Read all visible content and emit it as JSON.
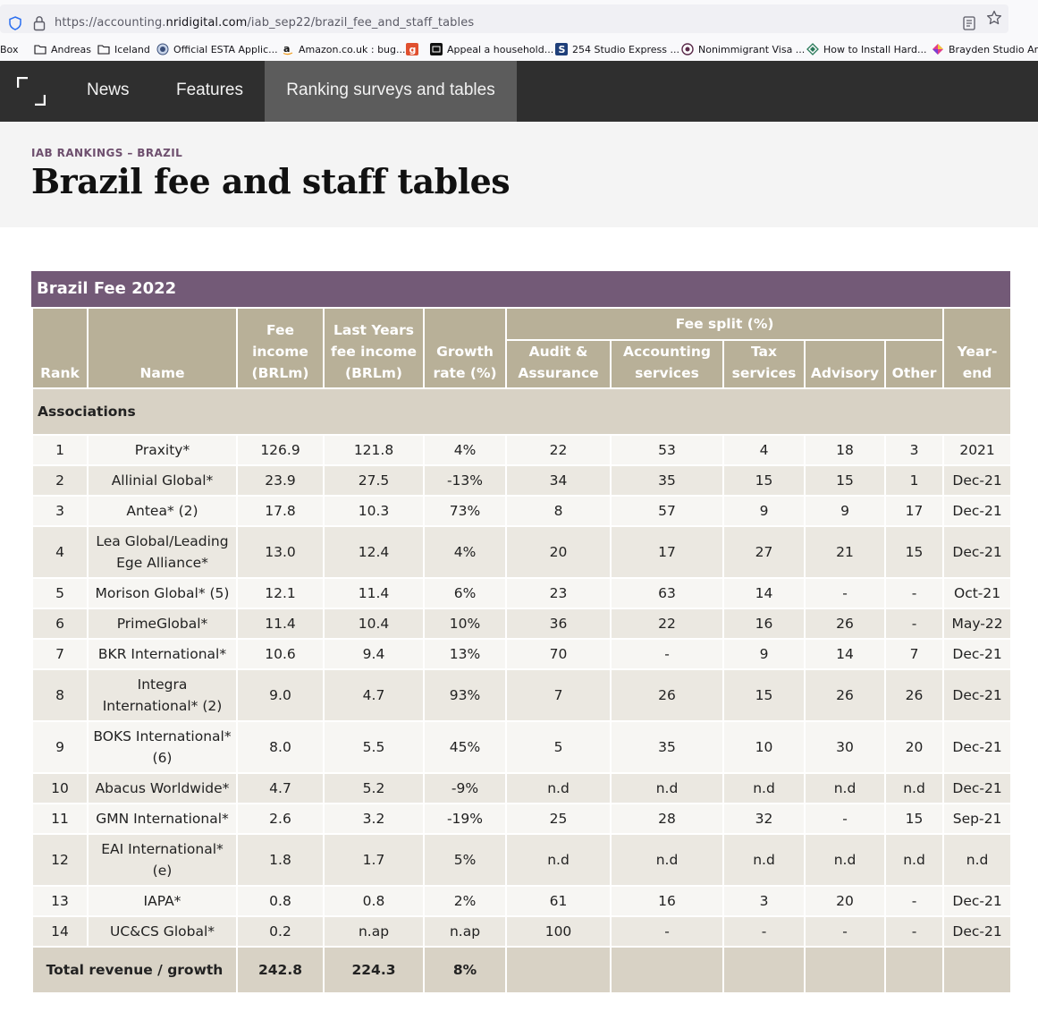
{
  "browser": {
    "url_prefix": "https://accounting.",
    "url_domain": "nridigital.com",
    "url_path": "/iab_sep22/brazil_fee_and_staff_tables",
    "bookmarks": [
      {
        "label": "Box",
        "icon": "folder-icon"
      },
      {
        "label": "Andreas",
        "icon": "folder-icon"
      },
      {
        "label": "Iceland",
        "icon": "folder-icon"
      },
      {
        "label": "Official ESTA Applic...",
        "icon": "seal-icon"
      },
      {
        "label": "Amazon.co.uk : bug...",
        "icon": "amazon-icon"
      },
      {
        "label": "",
        "icon": "g-icon"
      },
      {
        "label": "Appeal a household...",
        "icon": "gov-icon"
      },
      {
        "label": "254 Studio Express ...",
        "icon": "s-icon"
      },
      {
        "label": "Nonimmigrant Visa ...",
        "icon": "seal-icon"
      },
      {
        "label": "How to Install Hard...",
        "icon": "diamond-icon"
      },
      {
        "label": "Brayden Studio Ara...",
        "icon": "colorful-icon"
      }
    ]
  },
  "nav": {
    "items": [
      "News",
      "Features",
      "Ranking surveys and tables"
    ]
  },
  "header": {
    "kicker": "IAB RANKINGS – BRAZIL",
    "title": "Brazil fee and staff tables"
  },
  "table": {
    "title": "Brazil Fee 2022",
    "headers": {
      "rank": "Rank",
      "name": "Name",
      "fee_income": [
        "Fee",
        "income",
        "(BRLm)"
      ],
      "last_years": [
        "Last Years",
        "fee income",
        "(BRLm)"
      ],
      "growth": [
        "Growth",
        "rate (%)"
      ],
      "fee_split": "Fee split (%)",
      "audit": [
        "Audit &",
        "Assurance"
      ],
      "accounting": [
        "Accounting",
        "services"
      ],
      "tax": [
        "Tax",
        "services"
      ],
      "advisory": "Advisory",
      "other": "Other",
      "year_end": [
        "Year-",
        "end"
      ]
    },
    "section": "Associations",
    "rows": [
      {
        "rank": "1",
        "name": [
          "Praxity*"
        ],
        "fee": "126.9",
        "last": "121.8",
        "growth": "4%",
        "audit": "22",
        "acc": "53",
        "tax": "4",
        "adv": "18",
        "other": "3",
        "ye": "2021"
      },
      {
        "rank": "2",
        "name": [
          "Allinial Global*"
        ],
        "fee": "23.9",
        "last": "27.5",
        "growth": "-13%",
        "audit": "34",
        "acc": "35",
        "tax": "15",
        "adv": "15",
        "other": "1",
        "ye": "Dec-21"
      },
      {
        "rank": "3",
        "name": [
          "Antea* (2)"
        ],
        "fee": "17.8",
        "last": "10.3",
        "growth": "73%",
        "audit": "8",
        "acc": "57",
        "tax": "9",
        "adv": "9",
        "other": "17",
        "ye": "Dec-21"
      },
      {
        "rank": "4",
        "name": [
          "Lea Global/Leading",
          "Ege Alliance*"
        ],
        "fee": "13.0",
        "last": "12.4",
        "growth": "4%",
        "audit": "20",
        "acc": "17",
        "tax": "27",
        "adv": "21",
        "other": "15",
        "ye": "Dec-21"
      },
      {
        "rank": "5",
        "name": [
          "Morison Global* (5)"
        ],
        "fee": "12.1",
        "last": "11.4",
        "growth": "6%",
        "audit": "23",
        "acc": "63",
        "tax": "14",
        "adv": "-",
        "other": "-",
        "ye": "Oct-21"
      },
      {
        "rank": "6",
        "name": [
          "PrimeGlobal*"
        ],
        "fee": "11.4",
        "last": "10.4",
        "growth": "10%",
        "audit": "36",
        "acc": "22",
        "tax": "16",
        "adv": "26",
        "other": "-",
        "ye": "May-22"
      },
      {
        "rank": "7",
        "name": [
          "BKR International*"
        ],
        "fee": "10.6",
        "last": "9.4",
        "growth": "13%",
        "audit": "70",
        "acc": "-",
        "tax": "9",
        "adv": "14",
        "other": "7",
        "ye": "Dec-21"
      },
      {
        "rank": "8",
        "name": [
          "Integra",
          "International* (2)"
        ],
        "fee": "9.0",
        "last": "4.7",
        "growth": "93%",
        "audit": "7",
        "acc": "26",
        "tax": "15",
        "adv": "26",
        "other": "26",
        "ye": "Dec-21"
      },
      {
        "rank": "9",
        "name": [
          "BOKS International*",
          "(6)"
        ],
        "fee": "8.0",
        "last": "5.5",
        "growth": "45%",
        "audit": "5",
        "acc": "35",
        "tax": "10",
        "adv": "30",
        "other": "20",
        "ye": "Dec-21"
      },
      {
        "rank": "10",
        "name": [
          "Abacus Worldwide*"
        ],
        "fee": "4.7",
        "last": "5.2",
        "growth": "-9%",
        "audit": "n.d",
        "acc": "n.d",
        "tax": "n.d",
        "adv": "n.d",
        "other": "n.d",
        "ye": "Dec-21"
      },
      {
        "rank": "11",
        "name": [
          "GMN International*"
        ],
        "fee": "2.6",
        "last": "3.2",
        "growth": "-19%",
        "audit": "25",
        "acc": "28",
        "tax": "32",
        "adv": "-",
        "other": "15",
        "ye": "Sep-21"
      },
      {
        "rank": "12",
        "name": [
          "EAI International*",
          "(e)"
        ],
        "fee": "1.8",
        "last": "1.7",
        "growth": "5%",
        "audit": "n.d",
        "acc": "n.d",
        "tax": "n.d",
        "adv": "n.d",
        "other": "n.d",
        "ye": "n.d"
      },
      {
        "rank": "13",
        "name": [
          "IAPA*"
        ],
        "fee": "0.8",
        "last": "0.8",
        "growth": "2%",
        "audit": "61",
        "acc": "16",
        "tax": "3",
        "adv": "20",
        "other": "-",
        "ye": "Dec-21"
      },
      {
        "rank": "14",
        "name": [
          "UC&CS Global*"
        ],
        "fee": "0.2",
        "last": "n.ap",
        "growth": "n.ap",
        "audit": "100",
        "acc": "-",
        "tax": "-",
        "adv": "-",
        "other": "-",
        "ye": "Dec-21"
      }
    ],
    "total": {
      "label": "Total revenue / growth",
      "fee": "242.8",
      "last": "224.3",
      "growth": "8%"
    }
  }
}
